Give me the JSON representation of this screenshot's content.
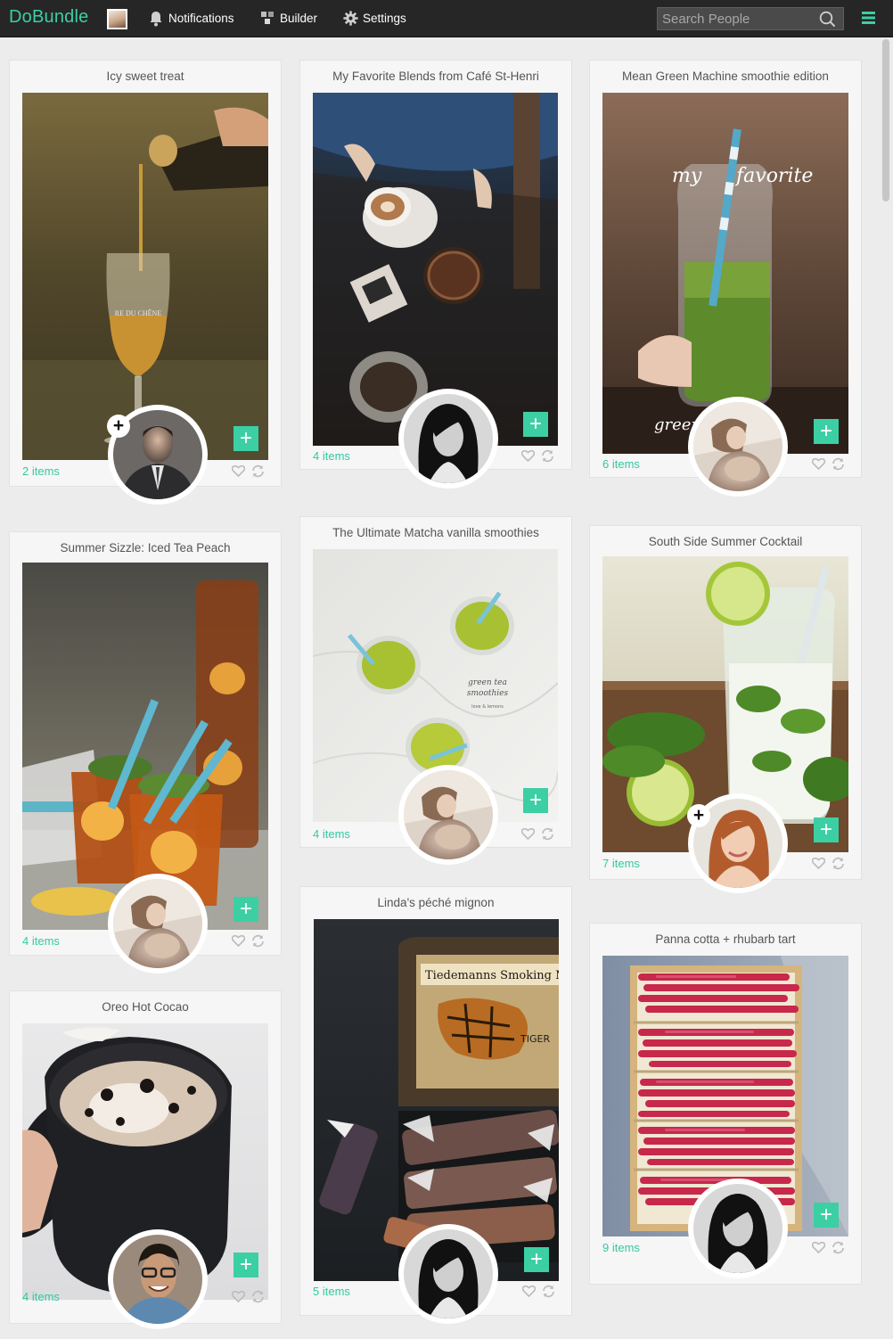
{
  "app": {
    "name": "DoBundle"
  },
  "nav": {
    "notifications": "Notifications",
    "builder": "Builder",
    "settings": "Settings"
  },
  "search": {
    "placeholder": "Search People"
  },
  "colors": {
    "accent": "#3ccfa4",
    "topbar": "#262626",
    "background": "#ececec"
  },
  "bundles": [
    {
      "title": "Icy sweet treat",
      "items": "2 items",
      "image": "wine-pour-photo",
      "owner": "man-in-suit-avatar",
      "following": false
    },
    {
      "title": "My Favorite Blends from Café St-Henri",
      "items": "4 items",
      "image": "coffee-table-photo",
      "owner": "woman-bw-avatar"
    },
    {
      "title": "Mean Green Machine smoothie edition",
      "items": "6 items",
      "image": "green-smoothie-jar-photo",
      "owner": "mother-baby-avatar"
    },
    {
      "title": "Summer Sizzle: Iced Tea Peach",
      "items": "4 items",
      "image": "iced-tea-photo",
      "owner": "mother-baby-avatar"
    },
    {
      "title": "The Ultimate Matcha vanilla smoothies",
      "items": "4 items",
      "image": "matcha-smoothies-photo",
      "owner": "mother-baby-avatar"
    },
    {
      "title": "South Side Summer Cocktail",
      "items": "7 items",
      "image": "lime-mint-cocktail-photo",
      "owner": "smiling-woman-avatar",
      "following": false
    },
    {
      "title": "Oreo Hot Cocao",
      "items": "4 items",
      "image": "hot-cocoa-mug-photo",
      "owner": "man-glasses-avatar"
    },
    {
      "title": "Linda's péché mignon",
      "items": "5 items",
      "image": "caramels-tin-photo",
      "owner": "woman-bw-avatar"
    },
    {
      "title": "Panna cotta + rhubarb tart",
      "items": "9 items",
      "image": "rhubarb-tart-photo",
      "owner": "woman-bw-avatar"
    }
  ],
  "photo_text": {
    "wine_glass": "RE DU CHÊNE",
    "jar_note_1": "my",
    "jar_note_2": "favorite",
    "jar_note_3": "green",
    "matcha_note_1": "green tea",
    "matcha_note_2": "smoothies",
    "matcha_note_3": "love & lemons",
    "tin_label": "Tiedemanns Smoking Mi",
    "tin_tiger": "TIGER"
  },
  "buttons": {
    "add": "+",
    "follow": "+"
  }
}
